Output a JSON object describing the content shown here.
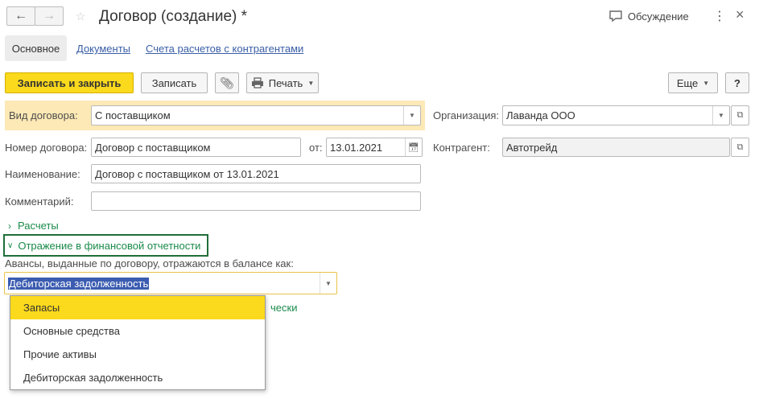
{
  "header": {
    "title": "Договор (создание) *",
    "discussion_label": "Обсуждение",
    "back_icon": "arrow-left-icon",
    "forward_icon": "arrow-right-icon"
  },
  "tabs": [
    {
      "label": "Основное",
      "active": true
    },
    {
      "label": "Документы",
      "active": false
    },
    {
      "label": "Счета расчетов с контрагентами",
      "active": false
    }
  ],
  "toolbar": {
    "save_close_label": "Записать и закрыть",
    "save_label": "Записать",
    "print_label": "Печать",
    "more_label": "Еще",
    "help_label": "?"
  },
  "form": {
    "contract_type": {
      "label": "Вид договора:",
      "value": "С поставщиком"
    },
    "organization": {
      "label": "Организация:",
      "value": "Лаванда ООО"
    },
    "contract_number": {
      "label": "Номер договора:",
      "value": "Договор с поставщиком"
    },
    "date": {
      "label": "от:",
      "value": "13.01.2021"
    },
    "counterparty": {
      "label": "Контрагент:",
      "value": "Автотрейд"
    },
    "name": {
      "label": "Наименование:",
      "value": "Договор с поставщиком от 13.01.2021"
    },
    "comment": {
      "label": "Комментарий:",
      "value": ""
    }
  },
  "groups": {
    "settlements": "Расчеты",
    "financial": "Отражение в финансовой отчетности"
  },
  "advances": {
    "label": "Авансы, выданные по договору, отражаются в балансе как:",
    "value": "Дебиторская задолженность",
    "hidden_link_tail": "чески"
  },
  "dropdown": {
    "options": [
      "Запасы",
      "Основные средства",
      "Прочие активы",
      "Дебиторская задолженность"
    ],
    "highlighted_index": 0
  },
  "colors": {
    "accent_yellow": "#fbd91c",
    "highlight_bg": "#fde9b5",
    "link_blue": "#3a5ea6",
    "group_green": "#1a8a4a",
    "frame_green": "#1f6e3a"
  }
}
